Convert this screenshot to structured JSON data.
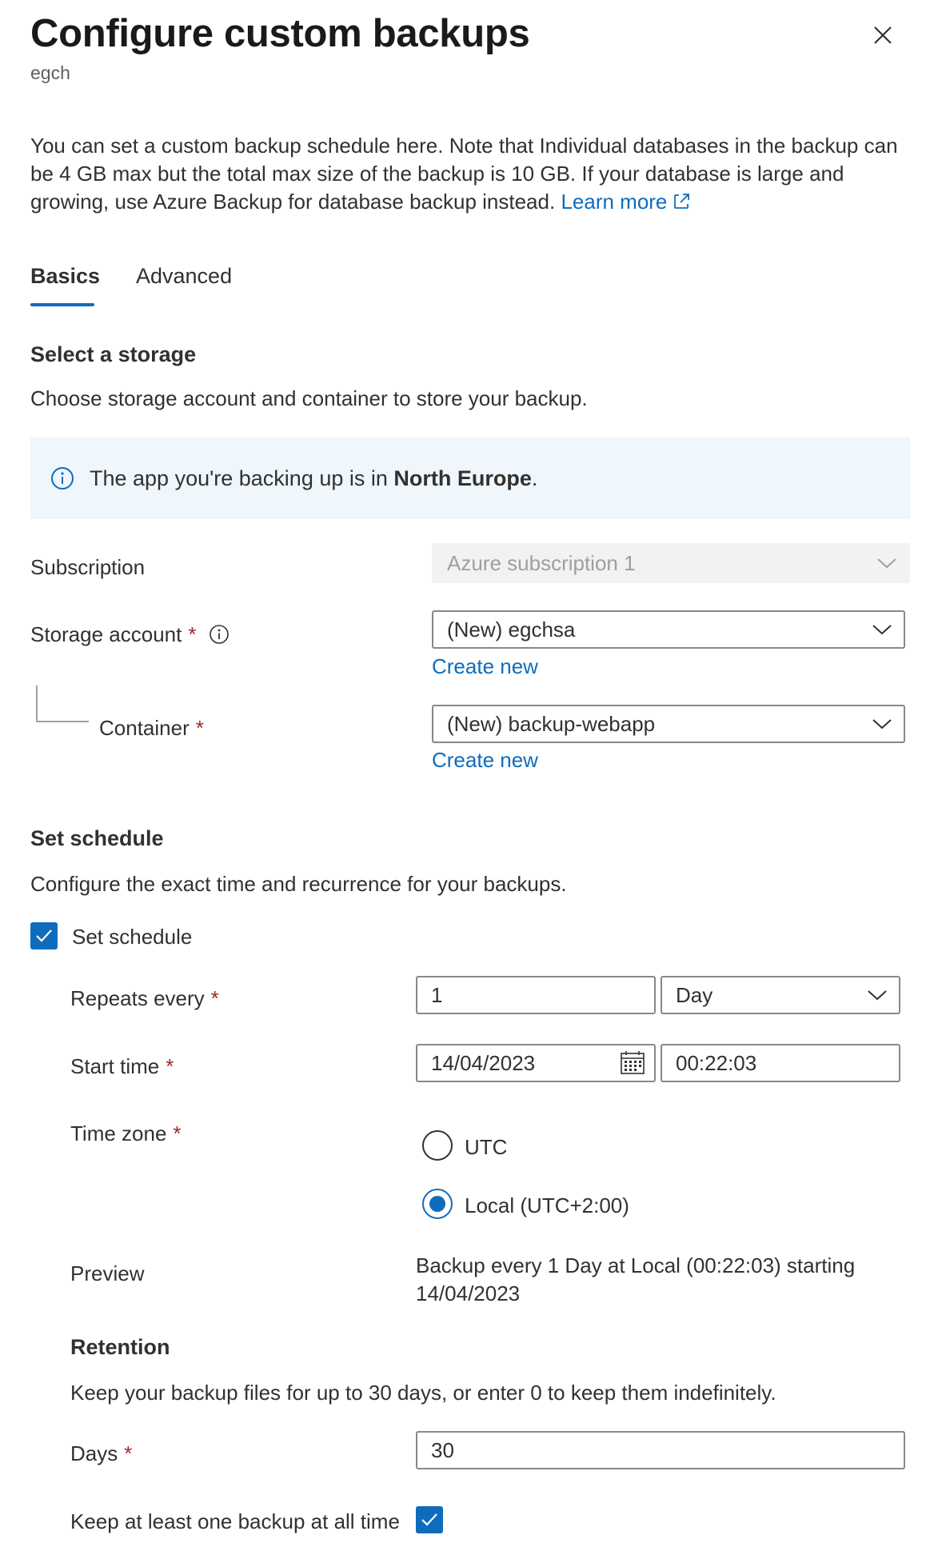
{
  "header": {
    "title": "Configure custom backups",
    "subtitle": "egch",
    "close_label": "Close"
  },
  "intro": {
    "text": "You can set a custom backup schedule here. Note that Individual databases in the backup can be 4 GB max but the total max size of the backup is 10 GB. If your database is large and growing, use Azure Backup for database backup instead.",
    "link_label": "Learn more"
  },
  "tabs": [
    {
      "label": "Basics",
      "selected": true
    },
    {
      "label": "Advanced",
      "selected": false
    }
  ],
  "storage": {
    "heading": "Select a storage",
    "description": "Choose storage account and container to store your backup.",
    "info": {
      "prefix": "The app you're backing up is in ",
      "region": "North Europe",
      "suffix": "."
    },
    "subscription": {
      "label": "Subscription",
      "value": "Azure subscription 1"
    },
    "storage_account": {
      "label": "Storage account",
      "required_mark": "*",
      "value": "(New) egchsa",
      "create_new": "Create new"
    },
    "container": {
      "label": "Container",
      "required_mark": "*",
      "value": "(New) backup-webapp",
      "create_new": "Create new"
    }
  },
  "schedule": {
    "heading": "Set schedule",
    "description": "Configure the exact time and recurrence for your backups.",
    "checkbox_label": "Set schedule",
    "checkbox_checked": true,
    "repeats": {
      "label": "Repeats every",
      "required_mark": "*",
      "value": "1",
      "unit": "Day"
    },
    "start_time": {
      "label": "Start time",
      "required_mark": "*",
      "date": "14/04/2023",
      "time": "00:22:03"
    },
    "time_zone": {
      "label": "Time zone",
      "required_mark": "*",
      "options": [
        {
          "label": "UTC",
          "selected": false
        },
        {
          "label": "Local (UTC+2:00)",
          "selected": true
        }
      ]
    },
    "preview": {
      "label": "Preview",
      "line1": "Backup every 1 Day at Local (00:22:03) starting",
      "line2": "14/04/2023"
    }
  },
  "retention": {
    "heading": "Retention",
    "description": "Keep your backup files for up to 30 days, or enter 0 to keep them indefinitely.",
    "days": {
      "label": "Days",
      "required_mark": "*",
      "value": "30"
    },
    "keep_one": {
      "label": "Keep at least one backup at all time",
      "checked": true
    }
  },
  "colors": {
    "accent": "#0f6cbd",
    "required": "#a4262c",
    "info_bg": "#eff6fc"
  }
}
